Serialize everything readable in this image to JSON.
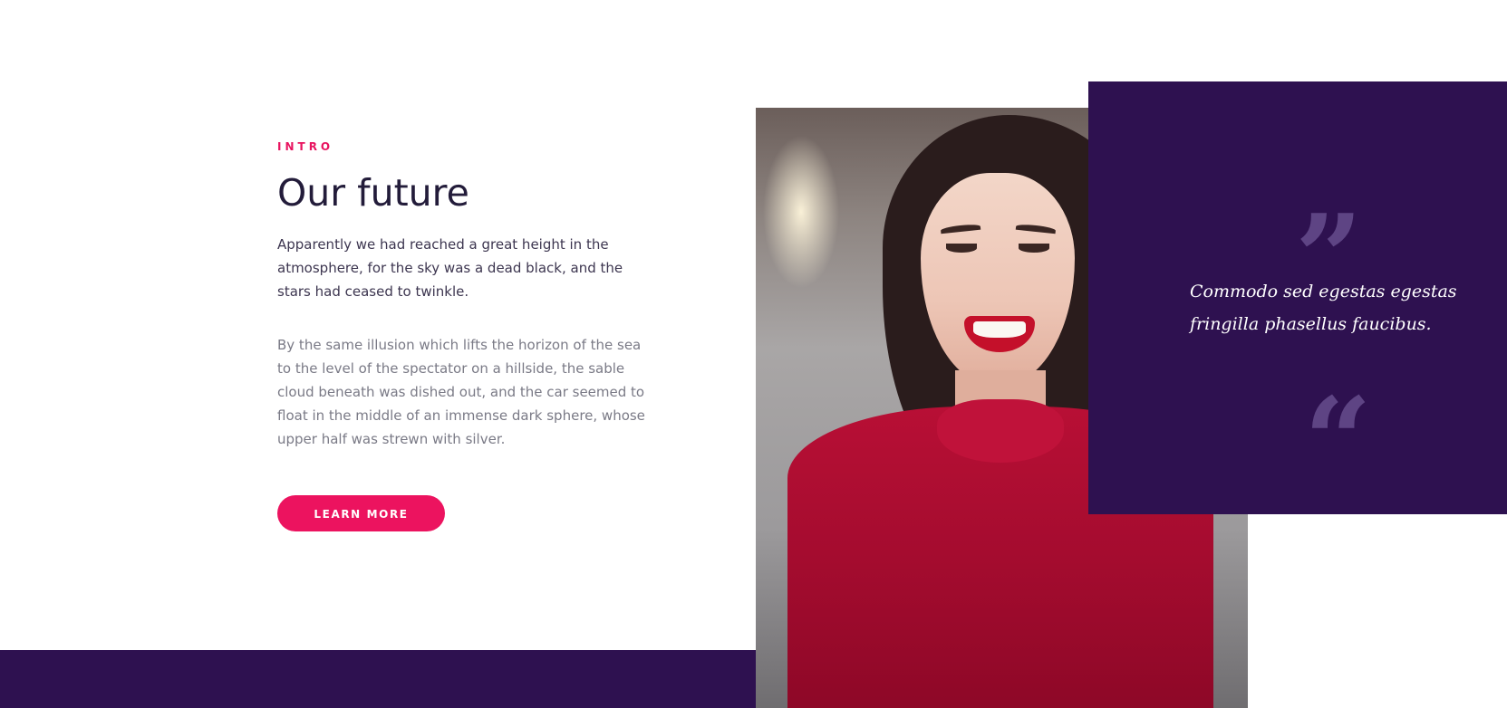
{
  "intro": {
    "eyebrow": "INTRO",
    "title": "Our future",
    "lead": "Apparently we had reached a great height in the atmosphere, for the sky was a dead black, and the stars had ceased to twinkle.",
    "body": "By the same illusion which lifts the horizon of the sea to the level of the spectator on a hillside, the sable cloud beneath was dished out, and the car seemed to float in the middle of an immense dark sphere, whose upper half was strewn with silver.",
    "cta_label": "LEARN MORE"
  },
  "quote": {
    "close_mark": "”",
    "text": "Commodo sed egestas egestas fringilla phasellus faucibus.",
    "open_mark": "“"
  },
  "colors": {
    "accent": "#ec135f",
    "panel": "#2e1150",
    "heading": "#231c3a",
    "quote_mark": "#5e4484"
  },
  "photo": {
    "subject": "portrait-smiling-woman-red-sweater"
  }
}
